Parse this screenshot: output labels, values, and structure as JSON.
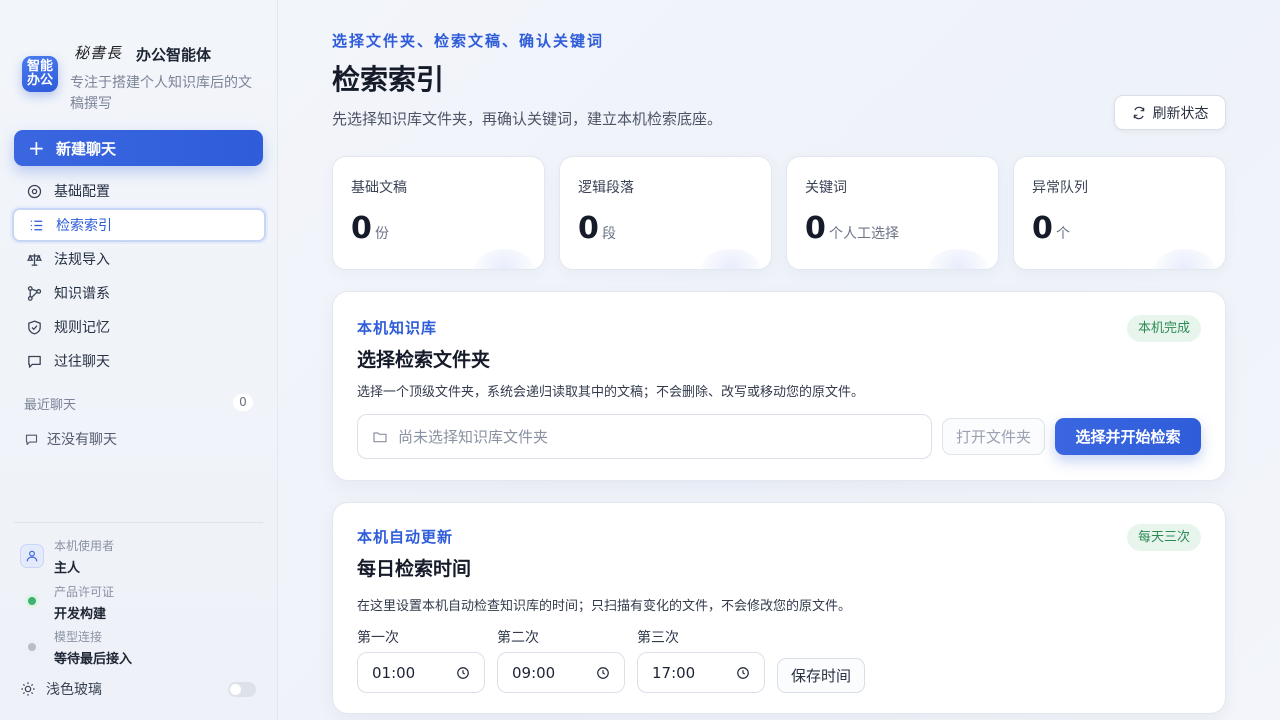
{
  "sidebar": {
    "brand": {
      "logo_text": "智能办公",
      "calligraphy": "秘書長",
      "name": "办公智能体",
      "tagline": "专注于搭建个人知识库后的文稿撰写"
    },
    "new_chat_label": "新建聊天",
    "nav": [
      {
        "label": "基础配置",
        "icon": "gear-icon"
      },
      {
        "label": "检索索引",
        "icon": "list-icon",
        "active": true
      },
      {
        "label": "法规导入",
        "icon": "scale-icon"
      },
      {
        "label": "知识谱系",
        "icon": "graph-icon"
      },
      {
        "label": "规则记忆",
        "icon": "shield-icon"
      },
      {
        "label": "过往聊天",
        "icon": "chat-icon"
      }
    ],
    "recent_label": "最近聊天",
    "recent_count": "0",
    "no_chat_label": "还没有聊天",
    "user": {
      "label": "本机使用者",
      "value": "主人"
    },
    "license": {
      "label": "产品许可证",
      "value": "开发构建",
      "status_color": "#3cb371"
    },
    "model": {
      "label": "模型连接",
      "value": "等待最后接入",
      "status_color": "#b8bec9"
    },
    "theme_label": "浅色玻璃",
    "theme_toggle_on": false
  },
  "header": {
    "eyebrow": "选择文件夹、检索文稿、确认关键词",
    "title": "检索索引",
    "description": "先选择知识库文件夹，再确认关键词，建立本机检索底座。",
    "refresh_label": "刷新状态"
  },
  "stats": [
    {
      "label": "基础文稿",
      "value": "0",
      "unit": "份"
    },
    {
      "label": "逻辑段落",
      "value": "0",
      "unit": "段"
    },
    {
      "label": "关键词",
      "value": "0",
      "unit": "个人工选择"
    },
    {
      "label": "异常队列",
      "value": "0",
      "unit": "个"
    }
  ],
  "library_panel": {
    "eyebrow": "本机知识库",
    "title": "选择检索文件夹",
    "badge": "本机完成",
    "description": "选择一个顶级文件夹，系统会递归读取其中的文稿；不会删除、改写或移动您的原文件。",
    "folder_placeholder": "尚未选择知识库文件夹",
    "open_folder_label": "打开文件夹",
    "start_label": "选择并开始检索"
  },
  "update_panel": {
    "eyebrow": "本机自动更新",
    "title": "每日检索时间",
    "badge": "每天三次",
    "description": "在这里设置本机自动检查知识库的时间；只扫描有变化的文件，不会修改您的原文件。",
    "times": [
      {
        "label": "第一次",
        "value": "01:00"
      },
      {
        "label": "第二次",
        "value": "09:00"
      },
      {
        "label": "第三次",
        "value": "17:00"
      }
    ],
    "save_label": "保存时间"
  },
  "colors": {
    "accent": "#2f5cd9",
    "badge_green": "#2e8a55"
  }
}
